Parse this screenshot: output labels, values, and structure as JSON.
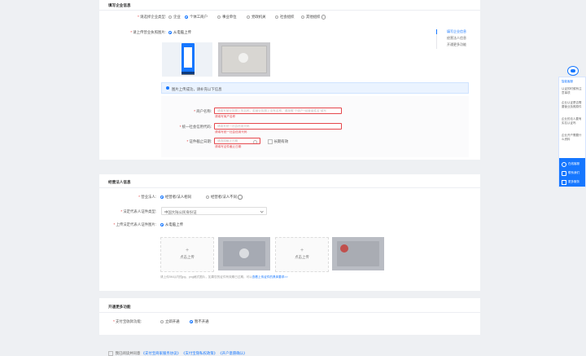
{
  "section1": {
    "title": "填写企业信息",
    "subject_type_label": "请选择企业类型:",
    "subject_types": [
      "企业",
      "个体工商户",
      "事业单位",
      "党政机关",
      "社会组织",
      "其他组织"
    ],
    "license_label": "请上传营业执照图片:",
    "upload_method": "从电脑上传",
    "notice": "图片上传成功，请补充以下信息",
    "merchant_name_label": "商户名称:",
    "merchant_name_placeholder": "请填写营业执照上的名称，若营业执照上没有名称，请按照\"个体户+经营者姓名\"填写",
    "merchant_name_error": "请填写商户名称",
    "credit_code_label": "统一社会信用代码:",
    "credit_code_placeholder": "请填写统一社会信用代码",
    "credit_code_error": "请填写统一社会信用代码",
    "expire_label": "证件截止日期:",
    "expire_placeholder": "请选择截止日期",
    "expire_long_term": "长期有效",
    "expire_error": "请填写证件截止日期"
  },
  "right_nav": [
    "填写企业信息",
    "经营法人信息",
    "开通更多功能"
  ],
  "section2": {
    "title": "经营法人信息",
    "legal_person_label": "营业法人:",
    "legal_options": [
      "经营者/法人相同",
      "经营者/法人不同"
    ],
    "id_type_label": "法定代表人证件类型:",
    "id_type_value": "中国大陆公民身份证",
    "id_upload_label": "上传法定代表人证件图片:",
    "upload_method": "从电脑上传",
    "upload_front": "点击上传",
    "upload_back": "点击上传",
    "hint": "请上传5M以内的jpg、png格式图片，如果您的证件有效期已过期，可以",
    "hint_link": "查看上传证件的具体要求>>"
  },
  "section3": {
    "title": "开通更多功能",
    "feature_label": "支付宝收款功能:",
    "options": [
      "立即开通",
      "暂不开通"
    ]
  },
  "agreement": {
    "prefix": "我已阅读并同意",
    "links": [
      "《支付宝商家服务协议》",
      "《支付宝隐私权政策》",
      "《开户意愿确认》"
    ]
  },
  "sidebar": {
    "title": "智能客服",
    "questions": [
      "认证的时候有注意事项",
      "企业认证是否需要营业执照原件",
      "企业的法人要有实名认证吗",
      "企业开户需要什么资料"
    ],
    "actions": [
      "在线客服",
      "联系我们",
      "更多服务"
    ]
  },
  "colors": {
    "accent": "#1677ff",
    "error": "#e5484d",
    "page_bg": "#eef0f3"
  }
}
